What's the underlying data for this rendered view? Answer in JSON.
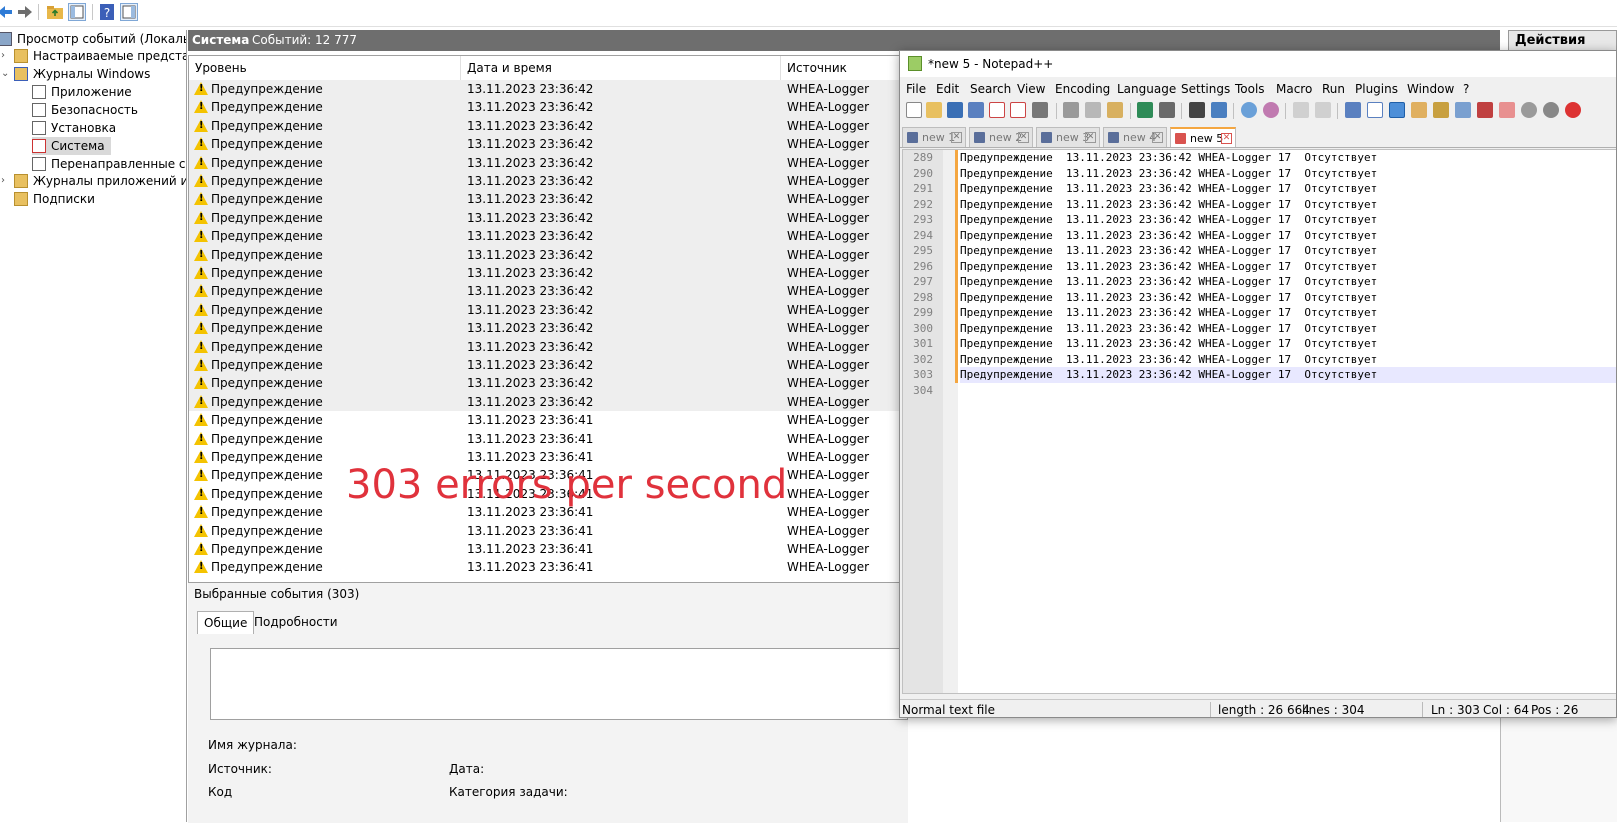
{
  "mmc": {
    "tree": {
      "root": "Просмотр событий (Локальный)",
      "custom_views": "Настраиваемые представления",
      "windows_logs": "Журналы Windows",
      "app": "Приложение",
      "security": "Безопасность",
      "setup": "Установка",
      "system": "Система",
      "forwarded": "Перенаправленные события",
      "app_services": "Журналы приложений и служб",
      "subscriptions": "Подписки"
    },
    "header": {
      "log_name": "Система",
      "events_count": "Событий: 12 777"
    },
    "actions_header": "Действия",
    "columns": {
      "level": "Уровень",
      "datetime": "Дата и время",
      "source": "Источник"
    },
    "rows": [
      {
        "level": "Предупреждение",
        "datetime": "13.11.2023 23:36:42",
        "source": "WHEA-Logger"
      },
      {
        "level": "Предупреждение",
        "datetime": "13.11.2023 23:36:42",
        "source": "WHEA-Logger"
      },
      {
        "level": "Предупреждение",
        "datetime": "13.11.2023 23:36:42",
        "source": "WHEA-Logger"
      },
      {
        "level": "Предупреждение",
        "datetime": "13.11.2023 23:36:42",
        "source": "WHEA-Logger"
      },
      {
        "level": "Предупреждение",
        "datetime": "13.11.2023 23:36:42",
        "source": "WHEA-Logger"
      },
      {
        "level": "Предупреждение",
        "datetime": "13.11.2023 23:36:42",
        "source": "WHEA-Logger"
      },
      {
        "level": "Предупреждение",
        "datetime": "13.11.2023 23:36:42",
        "source": "WHEA-Logger"
      },
      {
        "level": "Предупреждение",
        "datetime": "13.11.2023 23:36:42",
        "source": "WHEA-Logger"
      },
      {
        "level": "Предупреждение",
        "datetime": "13.11.2023 23:36:42",
        "source": "WHEA-Logger"
      },
      {
        "level": "Предупреждение",
        "datetime": "13.11.2023 23:36:42",
        "source": "WHEA-Logger"
      },
      {
        "level": "Предупреждение",
        "datetime": "13.11.2023 23:36:42",
        "source": "WHEA-Logger"
      },
      {
        "level": "Предупреждение",
        "datetime": "13.11.2023 23:36:42",
        "source": "WHEA-Logger"
      },
      {
        "level": "Предупреждение",
        "datetime": "13.11.2023 23:36:42",
        "source": "WHEA-Logger"
      },
      {
        "level": "Предупреждение",
        "datetime": "13.11.2023 23:36:42",
        "source": "WHEA-Logger"
      },
      {
        "level": "Предупреждение",
        "datetime": "13.11.2023 23:36:42",
        "source": "WHEA-Logger"
      },
      {
        "level": "Предупреждение",
        "datetime": "13.11.2023 23:36:42",
        "source": "WHEA-Logger"
      },
      {
        "level": "Предупреждение",
        "datetime": "13.11.2023 23:36:42",
        "source": "WHEA-Logger"
      },
      {
        "level": "Предупреждение",
        "datetime": "13.11.2023 23:36:42",
        "source": "WHEA-Logger"
      },
      {
        "level": "Предупреждение",
        "datetime": "13.11.2023 23:36:41",
        "source": "WHEA-Logger"
      },
      {
        "level": "Предупреждение",
        "datetime": "13.11.2023 23:36:41",
        "source": "WHEA-Logger"
      },
      {
        "level": "Предупреждение",
        "datetime": "13.11.2023 23:36:41",
        "source": "WHEA-Logger"
      },
      {
        "level": "Предупреждение",
        "datetime": "13.11.2023 23:36:41",
        "source": "WHEA-Logger"
      },
      {
        "level": "Предупреждение",
        "datetime": "13.11.2023 23:36:41",
        "source": "WHEA-Logger"
      },
      {
        "level": "Предупреждение",
        "datetime": "13.11.2023 23:36:41",
        "source": "WHEA-Logger"
      },
      {
        "level": "Предупреждение",
        "datetime": "13.11.2023 23:36:41",
        "source": "WHEA-Logger"
      },
      {
        "level": "Предупреждение",
        "datetime": "13.11.2023 23:36:41",
        "source": "WHEA-Logger"
      },
      {
        "level": "Предупреждение",
        "datetime": "13.11.2023 23:36:41",
        "source": "WHEA-Logger"
      }
    ],
    "overlay_text": "303 errors per second",
    "details": {
      "title": "Выбранные события (303)",
      "tab_general": "Общие",
      "tab_details": "Подробности",
      "log_name_label": "Имя журнала:",
      "source_label": "Источник:",
      "date_label": "Дата:",
      "code_label": "Код",
      "task_category_label": "Категория задачи:"
    }
  },
  "npp": {
    "title": "*new 5 - Notepad++",
    "menu": [
      "File",
      "Edit",
      "Search",
      "View",
      "Encoding",
      "Language",
      "Settings",
      "Tools",
      "Macro",
      "Run",
      "Plugins",
      "Window",
      "?"
    ],
    "tabs": [
      "new 1",
      "new 2",
      "new 3",
      "new 4",
      "new 5"
    ],
    "active_tab": "new 5",
    "lines": [
      {
        "n": "289",
        "text": "Предупреждение  13.11.2023 23:36:42 WHEA-Logger 17  Отсутствует"
      },
      {
        "n": "290",
        "text": "Предупреждение  13.11.2023 23:36:42 WHEA-Logger 17  Отсутствует"
      },
      {
        "n": "291",
        "text": "Предупреждение  13.11.2023 23:36:42 WHEA-Logger 17  Отсутствует"
      },
      {
        "n": "292",
        "text": "Предупреждение  13.11.2023 23:36:42 WHEA-Logger 17  Отсутствует"
      },
      {
        "n": "293",
        "text": "Предупреждение  13.11.2023 23:36:42 WHEA-Logger 17  Отсутствует"
      },
      {
        "n": "294",
        "text": "Предупреждение  13.11.2023 23:36:42 WHEA-Logger 17  Отсутствует"
      },
      {
        "n": "295",
        "text": "Предупреждение  13.11.2023 23:36:42 WHEA-Logger 17  Отсутствует"
      },
      {
        "n": "296",
        "text": "Предупреждение  13.11.2023 23:36:42 WHEA-Logger 17  Отсутствует"
      },
      {
        "n": "297",
        "text": "Предупреждение  13.11.2023 23:36:42 WHEA-Logger 17  Отсутствует"
      },
      {
        "n": "298",
        "text": "Предупреждение  13.11.2023 23:36:42 WHEA-Logger 17  Отсутствует"
      },
      {
        "n": "299",
        "text": "Предупреждение  13.11.2023 23:36:42 WHEA-Logger 17  Отсутствует"
      },
      {
        "n": "300",
        "text": "Предупреждение  13.11.2023 23:36:42 WHEA-Logger 17  Отсутствует"
      },
      {
        "n": "301",
        "text": "Предупреждение  13.11.2023 23:36:42 WHEA-Logger 17  Отсутствует"
      },
      {
        "n": "302",
        "text": "Предупреждение  13.11.2023 23:36:42 WHEA-Logger 17  Отсутствует"
      },
      {
        "n": "303",
        "text": "Предупреждение  13.11.2023 23:36:42 WHEA-Logger 17  Отсутствует"
      },
      {
        "n": "304",
        "text": ""
      }
    ],
    "status": {
      "file_type": "Normal text file",
      "length": "length : 26 664",
      "lines": "lines : 304",
      "ln": "Ln : 303",
      "col": "Col : 64",
      "pos": "Pos : 26"
    }
  }
}
